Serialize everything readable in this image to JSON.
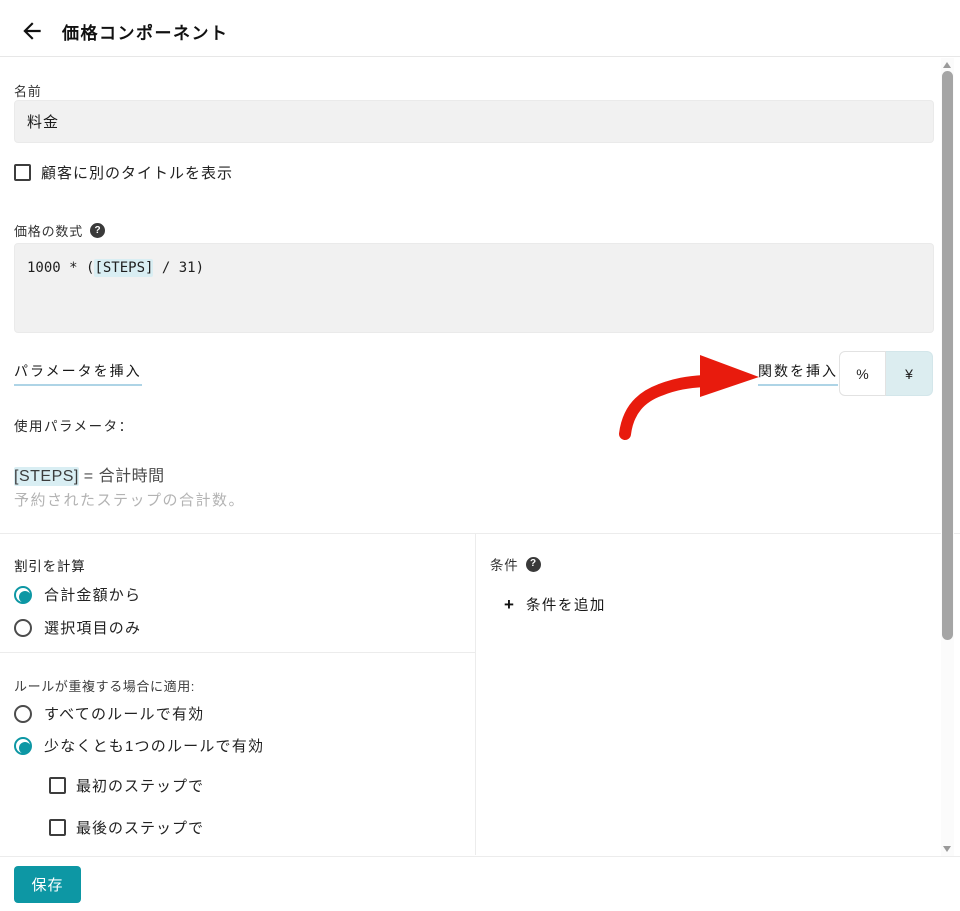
{
  "accent_color": "#0d97a4",
  "highlight_color": "#d9eef3",
  "arrow_color": "#e81b0d",
  "header": {
    "title": "価格コンポーネント"
  },
  "name_section": {
    "label": "名前",
    "value": "料金",
    "alt_title_checkbox_label": "顧客に別のタイトルを表示",
    "alt_title_checked": false
  },
  "formula_section": {
    "label": "価格の数式",
    "formula_prefix": "1000 * (",
    "formula_param": "[STEPS]",
    "formula_suffix": " / 31)",
    "insert_parameter_label": "パラメータを挿入",
    "insert_function_label": "関数を挿入",
    "unit_toggle": {
      "options": [
        "%",
        "¥"
      ],
      "selected": "¥"
    }
  },
  "used_params": {
    "label": "使用パラメータ：",
    "param_token": "[STEPS]",
    "param_equals": " = 合計時間",
    "description": "予約されたステップの合計数。"
  },
  "discount_section": {
    "label": "割引を計算",
    "options": [
      {
        "label": "合計金額から",
        "selected": true
      },
      {
        "label": "選択項目のみ",
        "selected": false
      }
    ]
  },
  "overlap_section": {
    "label": "ルールが重複する場合に適用:",
    "options": [
      {
        "label": "すべてのルールで有効",
        "selected": false
      },
      {
        "label": "少なくとも1つのルールで有効",
        "selected": true
      }
    ],
    "checkboxes": [
      {
        "label": "最初のステップで",
        "checked": false
      },
      {
        "label": "最後のステップで",
        "checked": false
      }
    ]
  },
  "conditions_section": {
    "label": "条件",
    "plus_icon": "+",
    "add_button_label": "条件を追加",
    "help_icon": "?"
  },
  "footer": {
    "save_label": "保存"
  }
}
